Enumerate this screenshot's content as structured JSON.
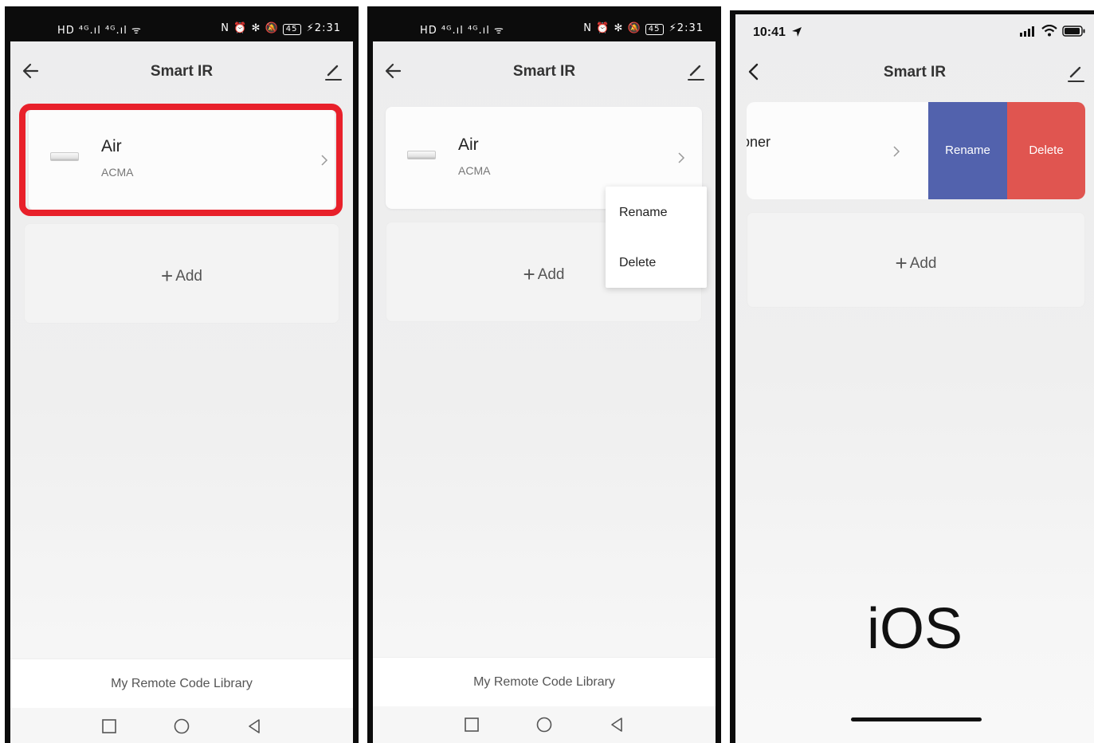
{
  "android_status": {
    "left": "HD ⁴ᴳ.ıl ⁴ᴳ.ıl ᯤ",
    "right": "N ⏰ ✻ 🔕",
    "battery": "45",
    "time": "⚡2:31"
  },
  "header": {
    "title": "Smart IR"
  },
  "device": {
    "name": "Air",
    "brand": "ACMA",
    "name_truncated": "oner"
  },
  "add": {
    "plus": "+",
    "label": "Add"
  },
  "footer": {
    "library_label": "My Remote Code Library"
  },
  "context_menu": {
    "rename": "Rename",
    "delete": "Delete"
  },
  "swipe_actions": {
    "rename": "Rename",
    "delete": "Delete",
    "rename_color": "#5262ad",
    "delete_color": "#e05550"
  },
  "ios_status": {
    "time": "10:41",
    "location_icon": "location-arrow-icon"
  },
  "ios_label": "iOS",
  "colors": {
    "highlight": "#e8202a",
    "background": "#efefef"
  }
}
